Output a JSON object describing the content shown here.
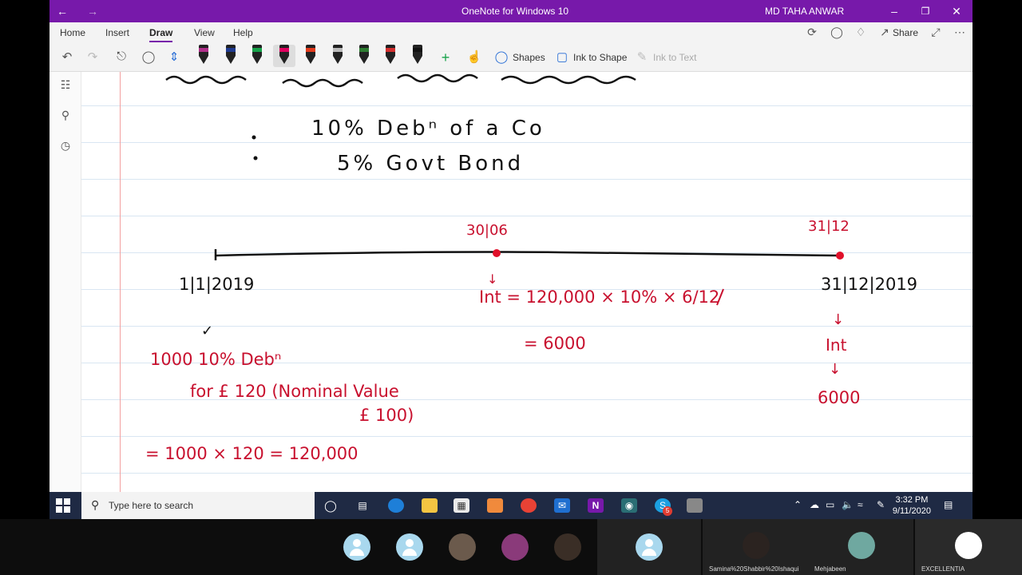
{
  "window": {
    "title": "OneNote for Windows 10",
    "user": "MD TAHA ANWAR",
    "back_icon": "back-arrow-icon",
    "forward_icon": "forward-arrow-icon"
  },
  "ribbon": {
    "tabs": [
      "Home",
      "Insert",
      "Draw",
      "View",
      "Help"
    ],
    "active_tab": "Draw",
    "share_label": "Share"
  },
  "toolbar": {
    "shapes_label": "Shapes",
    "ink_to_shape_label": "Ink to Shape",
    "ink_to_text_label": "Ink to Text",
    "pen_colors": [
      "#b02f8a",
      "#1f3a8f",
      "#17a34a",
      "#e0005f",
      "#e23a1c",
      "#444444",
      "#2e7d32",
      "#d32f2f",
      "#111111"
    ]
  },
  "notes": {
    "line1": "10% Debⁿ of a Co",
    "line2": "5% Govt Bond",
    "date_start": "1|1|2019",
    "mid_label": "30|06",
    "end_label": "31|12",
    "date_end": "31|12|2019",
    "check": "✓",
    "mid_calc1": "↓",
    "int_formula": "Int = 120,000 × 10% × 6/12",
    "int_result": "= 6000",
    "end_arrow1": "↓",
    "end_int": "Int",
    "end_arrow2": "↓",
    "end_value": "6000",
    "deb_line1": "1000   10% Debⁿ",
    "deb_line2": "for £ 120 (Nominal Value",
    "deb_line3": "£ 100)",
    "total_line": "=    1000 × 120   =   120,000"
  },
  "taskbar": {
    "search_placeholder": "Type here to search",
    "time": "3:32 PM",
    "date": "9/11/2020",
    "badge_count": "5"
  },
  "meeting": {
    "participants": [
      "Samina%20Shabbir%20Ishaqui",
      "Mehjabeen",
      "EXCELLENTIA"
    ]
  }
}
